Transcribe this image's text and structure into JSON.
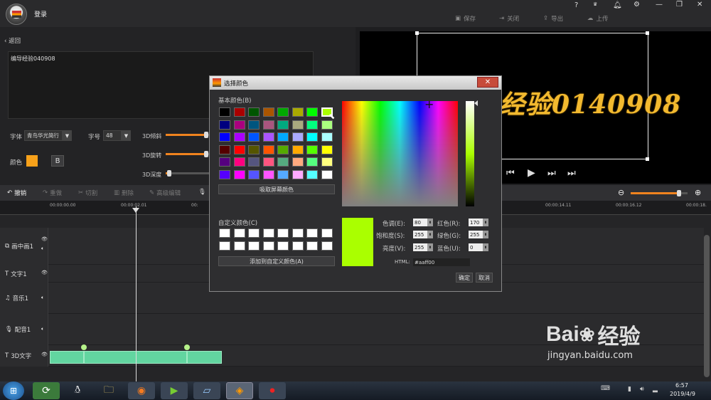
{
  "app": {
    "login_label": "登录"
  },
  "topbar": {
    "save": "保存",
    "close": "关闭",
    "export": "导出",
    "upload": "上传",
    "window_controls": [
      "?",
      "VIP",
      "bell",
      "gear",
      "—",
      "❐",
      "✕"
    ]
  },
  "left": {
    "back_label": "返回",
    "text_content": "编导经验040908",
    "font_label": "字体",
    "font_value": "青鸟华光简行",
    "size_label": "字号",
    "size_value": "48",
    "color_label": "颜色",
    "color_value": "#f7a11a",
    "bold_label": "B",
    "tilt_label": "3D倾斜",
    "rotate_label": "3D旋转",
    "depth_label": "3D深度",
    "tilt_level": 0.92,
    "rotate_level": 0.92,
    "depth_level": 0.08
  },
  "preview": {
    "text": "经验0140908"
  },
  "toolbar": {
    "undo": "撤销",
    "redo": "重做",
    "cut": "切割",
    "delete": "删除",
    "advanced": "高级编辑"
  },
  "timeline": {
    "ticks": [
      "00:00:00.00",
      "00:00:02.01",
      "00:",
      "00:00:14.11",
      "00:00:16.12",
      "00:00:18."
    ],
    "tracks": [
      "画中画1",
      "文字1",
      "音乐1",
      "配音1",
      "3D文字"
    ],
    "zoom_level": 0.85
  },
  "dialog": {
    "title": "选择颜色",
    "basic_label": "基本颜色(B)",
    "pick_screen": "吸取屏幕颜色",
    "custom_label": "自定义颜色(C)",
    "add_custom": "添加到自定义颜色(A)",
    "hue_label": "色调(E):",
    "hue": "80",
    "sat_label": "饱和度(S):",
    "sat": "255",
    "lum_label": "亮度(V):",
    "lum": "255",
    "red_label": "红色(R):",
    "red": "170",
    "green_label": "绿色(G):",
    "green": "255",
    "blue_label": "蓝色(U):",
    "blue": "0",
    "html_label": "HTML:",
    "html": "#aaff00",
    "ok": "确定",
    "cancel": "取消",
    "current_color": "#aaff00",
    "basic_colors": [
      "#000000",
      "#aa0000",
      "#005500",
      "#aa5500",
      "#00aa00",
      "#aaaa00",
      "#00ff00",
      "#aaff00",
      "#00007f",
      "#aa007f",
      "#00557f",
      "#aa557f",
      "#00aa7f",
      "#aaaa7f",
      "#00ff7f",
      "#aaff7f",
      "#0000ff",
      "#aa00ff",
      "#0055ff",
      "#aa55ff",
      "#00aaff",
      "#aaaaff",
      "#00ffff",
      "#aaffff",
      "#550000",
      "#ff0000",
      "#555500",
      "#ff5500",
      "#55aa00",
      "#ffaa00",
      "#55ff00",
      "#ffff00",
      "#55007f",
      "#ff007f",
      "#55557f",
      "#ff557f",
      "#55aa7f",
      "#ffaa7f",
      "#55ff7f",
      "#ffff7f",
      "#5500ff",
      "#ff00ff",
      "#5555ff",
      "#ff55ff",
      "#55aaff",
      "#ffaaff",
      "#55ffff",
      "#ffffff"
    ]
  },
  "taskbar": {
    "time": "6:57",
    "date": "2019/4/9"
  },
  "watermark": {
    "brand": "Bai",
    "brand2": "经验",
    "url": "jingyan.baidu.com"
  }
}
